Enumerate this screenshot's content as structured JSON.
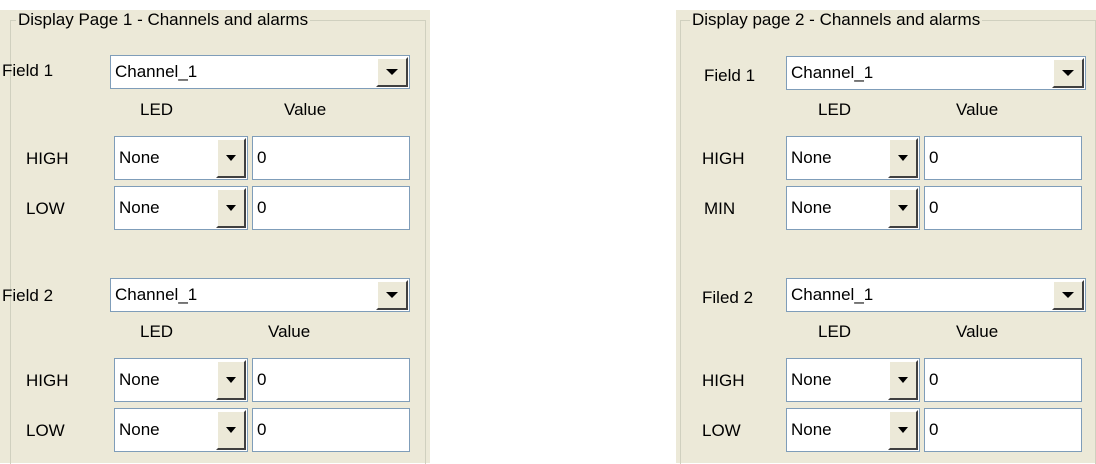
{
  "panel1": {
    "title": "Display Page 1 - Channels and alarms",
    "led_header": "LED",
    "value_header": "Value",
    "field1": {
      "label": "Field 1",
      "channel": "Channel_1",
      "row1": {
        "label": "HIGH",
        "led": "None",
        "value": "0"
      },
      "row2": {
        "label": "LOW",
        "led": "None",
        "value": "0"
      }
    },
    "field2": {
      "label": "Field 2",
      "channel": "Channel_1",
      "row1": {
        "label": "HIGH",
        "led": "None",
        "value": "0"
      },
      "row2": {
        "label": "LOW",
        "led": "None",
        "value": "0"
      }
    }
  },
  "panel2": {
    "title": "Display page 2 - Channels and alarms",
    "led_header": "LED",
    "value_header": "Value",
    "field1": {
      "label": "Field 1",
      "channel": "Channel_1",
      "row1": {
        "label": "HIGH",
        "led": "None",
        "value": "0"
      },
      "row2": {
        "label": "MIN",
        "led": "None",
        "value": "0"
      }
    },
    "field2": {
      "label": "Filed 2",
      "channel": "Channel_1",
      "row1": {
        "label": "HIGH",
        "led": "None",
        "value": "0"
      },
      "row2": {
        "label": "LOW",
        "led": "None",
        "value": "0"
      }
    }
  }
}
